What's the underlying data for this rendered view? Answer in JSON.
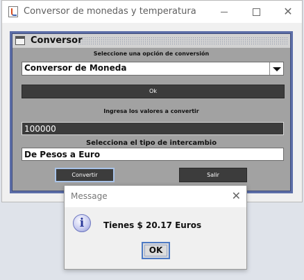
{
  "window": {
    "title": "Conversor de monedas y temperatura",
    "controls": [
      "minimize",
      "maximize",
      "close"
    ]
  },
  "internal_frame": {
    "title": "Conversor"
  },
  "form": {
    "option_label": "Seleccione una opción de conversión",
    "conversion_select_value": "Conversor de Moneda",
    "ok_label": "Ok",
    "values_label": "Ingresa los valores a convertir",
    "amount_value": "100000",
    "exchange_label": "Selecciona el tipo de intercambio",
    "exchange_value": "De Pesos a Euro",
    "convert_label": "Convertir",
    "exit_label": "Salir"
  },
  "dialog": {
    "title": "Message",
    "message": "Tienes $ 20.17 Euros",
    "ok_label": "OK",
    "icon": "info-icon"
  },
  "colors": {
    "frame_border": "#5c6ea8",
    "panel_bg": "#a2a2a2",
    "dark_control": "#3c3c3c",
    "focus_border": "#4d7ac4"
  }
}
